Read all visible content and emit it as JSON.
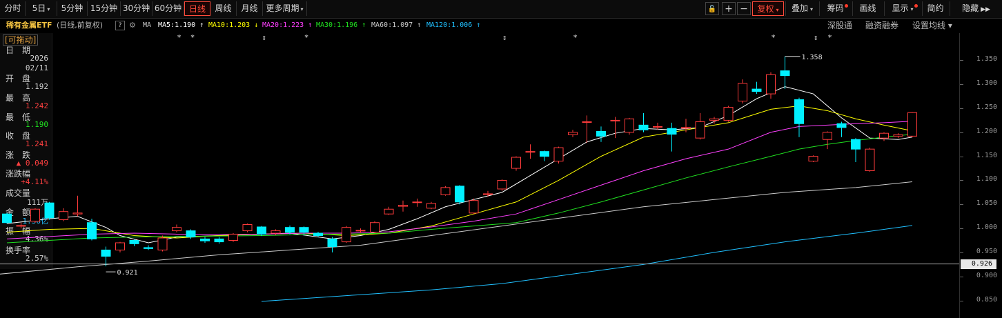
{
  "toolbar": {
    "periods": [
      {
        "label": "分时",
        "caret": false
      },
      {
        "label": "5日",
        "caret": true
      },
      {
        "label": "5分钟",
        "caret": false
      },
      {
        "label": "15分钟",
        "caret": false
      },
      {
        "label": "30分钟",
        "caret": false
      },
      {
        "label": "60分钟",
        "caret": false
      },
      {
        "label": "日线",
        "caret": false,
        "active": true
      },
      {
        "label": "周线",
        "caret": false
      },
      {
        "label": "月线",
        "caret": false
      },
      {
        "label": "更多周期",
        "caret": true
      }
    ],
    "icons": [
      "lock-open-icon",
      "zoom-in-icon",
      "zoom-out-icon"
    ],
    "icon_glyphs": [
      "🔓",
      "+",
      "−"
    ],
    "right_buttons": [
      {
        "label": "复权",
        "caret": true,
        "highlight": true
      },
      {
        "label": "叠加",
        "caret": true
      },
      {
        "label": "筹码",
        "dot": true
      },
      {
        "label": "画线"
      },
      {
        "label": "显示",
        "caret": true,
        "dot": true
      },
      {
        "label": "简约"
      },
      {
        "label": "隐藏",
        "arrows": "▶▶"
      }
    ]
  },
  "info": {
    "name": "稀有金属ETF",
    "mode": "(日线,前复权)",
    "help": "?",
    "ma_tag": "MA",
    "ma": [
      {
        "label": "MA5:1.190",
        "arrow": "↑",
        "color": "#ffffff"
      },
      {
        "label": "MA10:1.203",
        "arrow": "↓",
        "color": "#ffff00"
      },
      {
        "label": "MA20:1.223",
        "arrow": "↑",
        "color": "#ff40ff"
      },
      {
        "label": "MA30:1.196",
        "arrow": "↑",
        "color": "#20e020"
      },
      {
        "label": "MA60:1.097",
        "arrow": "↑",
        "color": "#cccccc"
      },
      {
        "label": "MA120:1.006",
        "arrow": "↑",
        "color": "#20c0ff"
      }
    ],
    "links": [
      "深股通",
      "融资融券",
      "设置均线"
    ]
  },
  "panel": {
    "title": "[可拖动]",
    "rows": [
      {
        "label": "日　期",
        "value": ""
      },
      {
        "label": "",
        "value": "2026"
      },
      {
        "label": "",
        "value": "02/11"
      },
      {
        "label": "开　盘",
        "value": ""
      },
      {
        "label": "",
        "value": "1.192"
      },
      {
        "label": "最　高",
        "value": ""
      },
      {
        "label": "",
        "value": "1.242",
        "color": "#ff4040"
      },
      {
        "label": "最　低",
        "value": ""
      },
      {
        "label": "",
        "value": "1.190",
        "color": "#20e020"
      },
      {
        "label": "收　盘",
        "value": ""
      },
      {
        "label": "",
        "value": "1.241",
        "color": "#ff4040"
      },
      {
        "label": "涨　跌",
        "value": ""
      },
      {
        "label": "",
        "value": "▲ 0.049",
        "color": "#ff4040"
      },
      {
        "label": "涨跌幅",
        "value": ""
      },
      {
        "label": "",
        "value": "+4.11%",
        "color": "#ff4040"
      },
      {
        "label": "成交量",
        "value": ""
      },
      {
        "label": "",
        "value": "111万"
      },
      {
        "label": "金　额",
        "value": ""
      },
      {
        "label": "",
        "value": "1.36亿",
        "color": "#20c0ff"
      },
      {
        "label": "振　幅",
        "value": ""
      },
      {
        "label": "",
        "value": "4.36%"
      },
      {
        "label": "换手率",
        "value": ""
      },
      {
        "label": "",
        "value": "2.57%"
      }
    ]
  },
  "chart_data": {
    "type": "candlestick",
    "ymin": 0.835,
    "ymax": 1.372,
    "yticks": [
      "1.350",
      "1.300",
      "1.250",
      "1.200",
      "1.150",
      "1.100",
      "1.050",
      "1.000",
      "0.950",
      "0.900",
      "0.850"
    ],
    "current_price": "0.926",
    "high_label": "1.358",
    "low_label": "0.921",
    "markers": [
      "*",
      "*",
      "⇕",
      "*",
      "⇕",
      "*",
      "*",
      "⇕",
      "*"
    ],
    "candles": [
      [
        1.03,
        1.012,
        1.032,
        1.01
      ],
      [
        1.006,
        1.006,
        1.012,
        1.0
      ],
      [
        1.015,
        1.04,
        1.042,
        1.012
      ],
      [
        1.053,
        1.022,
        1.055,
        1.018
      ],
      [
        1.018,
        1.035,
        1.042,
        1.015
      ],
      [
        1.03,
        1.032,
        1.068,
        1.025
      ],
      [
        1.012,
        0.978,
        1.02,
        0.975
      ],
      [
        0.955,
        0.942,
        0.962,
        0.921
      ],
      [
        0.955,
        0.97,
        0.972,
        0.95
      ],
      [
        0.975,
        0.968,
        0.978,
        0.963
      ],
      [
        0.96,
        0.958,
        0.965,
        0.955
      ],
      [
        0.955,
        0.98,
        0.985,
        0.952
      ],
      [
        0.995,
        1.002,
        1.008,
        0.992
      ],
      [
        0.995,
        0.982,
        0.998,
        0.978
      ],
      [
        0.978,
        0.974,
        0.982,
        0.97
      ],
      [
        0.978,
        0.972,
        0.982,
        0.968
      ],
      [
        0.975,
        0.988,
        0.99,
        0.972
      ],
      [
        0.995,
        1.008,
        1.01,
        0.992
      ],
      [
        1.003,
        0.988,
        1.005,
        0.984
      ],
      [
        0.99,
        0.995,
        0.998,
        0.986
      ],
      [
        1.002,
        0.992,
        1.006,
        0.988
      ],
      [
        1.002,
        0.992,
        1.004,
        0.985
      ],
      [
        0.99,
        0.985,
        0.993,
        0.982
      ],
      [
        0.978,
        0.962,
        0.982,
        0.95
      ],
      [
        0.972,
        1.002,
        1.005,
        0.97
      ],
      [
        0.995,
        0.996,
        1.0,
        0.99
      ],
      [
        0.992,
        1.012,
        1.015,
        0.99
      ],
      [
        1.03,
        1.04,
        1.045,
        1.028
      ],
      [
        1.046,
        1.048,
        1.058,
        1.035
      ],
      [
        1.055,
        1.055,
        1.062,
        1.045
      ],
      [
        1.042,
        1.052,
        1.055,
        1.04
      ],
      [
        1.07,
        1.085,
        1.088,
        1.068
      ],
      [
        1.088,
        1.055,
        1.09,
        1.05
      ],
      [
        1.032,
        1.058,
        1.062,
        1.03
      ],
      [
        1.072,
        1.072,
        1.078,
        1.066
      ],
      [
        1.082,
        1.1,
        1.102,
        1.078
      ],
      [
        1.125,
        1.148,
        1.15,
        1.12
      ],
      [
        1.16,
        1.16,
        1.175,
        1.145
      ],
      [
        1.16,
        1.15,
        1.162,
        1.14
      ],
      [
        1.14,
        1.168,
        1.17,
        1.135
      ],
      [
        1.195,
        1.2,
        1.205,
        1.19
      ],
      [
        1.222,
        1.222,
        1.235,
        1.178
      ],
      [
        1.202,
        1.192,
        1.212,
        1.18
      ],
      [
        1.225,
        1.225,
        1.232,
        1.188
      ],
      [
        1.2,
        1.228,
        1.23,
        1.195
      ],
      [
        1.215,
        1.205,
        1.24,
        1.2
      ],
      [
        1.212,
        1.212,
        1.22,
        1.205
      ],
      [
        1.208,
        1.196,
        1.22,
        1.16
      ],
      [
        1.21,
        1.21,
        1.228,
        1.2
      ],
      [
        1.188,
        1.222,
        1.24,
        1.185
      ],
      [
        1.225,
        1.228,
        1.232,
        1.218
      ],
      [
        1.225,
        1.252,
        1.255,
        1.222
      ],
      [
        1.265,
        1.302,
        1.31,
        1.26
      ],
      [
        1.29,
        1.285,
        1.305,
        1.28
      ],
      [
        1.28,
        1.32,
        1.325,
        1.27
      ],
      [
        1.328,
        1.318,
        1.358,
        1.29
      ],
      [
        1.268,
        1.218,
        1.272,
        1.19
      ],
      [
        1.14,
        1.15,
        1.152,
        1.138
      ],
      [
        1.185,
        1.2,
        1.202,
        1.165
      ],
      [
        1.218,
        1.21,
        1.222,
        1.19
      ],
      [
        1.185,
        1.165,
        1.188,
        1.138
      ],
      [
        1.12,
        1.165,
        1.168,
        1.118
      ],
      [
        1.188,
        1.198,
        1.2,
        1.182
      ],
      [
        1.192,
        1.195,
        1.198,
        1.188
      ],
      [
        1.192,
        1.241,
        1.242,
        1.19
      ]
    ],
    "ma_lines": [
      {
        "name": "MA5",
        "color": "#ffffff",
        "x": [
          0,
          3,
          5,
          7,
          8,
          10,
          12,
          15,
          18,
          20,
          23,
          25,
          27,
          29,
          31,
          33,
          35,
          37,
          39,
          41,
          43,
          45,
          47,
          49,
          51,
          53,
          55,
          57,
          59,
          61,
          63,
          64
        ],
        "y": [
          1.01,
          1.02,
          1.025,
          1.002,
          0.985,
          0.97,
          0.982,
          0.985,
          0.988,
          0.99,
          0.978,
          0.985,
          0.998,
          1.02,
          1.045,
          1.06,
          1.075,
          1.11,
          1.145,
          1.18,
          1.198,
          1.208,
          1.205,
          1.21,
          1.235,
          1.27,
          1.295,
          1.28,
          1.23,
          1.188,
          1.185,
          1.19
        ]
      },
      {
        "name": "MA10",
        "color": "#ffff00",
        "x": [
          0,
          3,
          6,
          9,
          12,
          15,
          18,
          21,
          24,
          27,
          30,
          33,
          36,
          39,
          42,
          45,
          48,
          51,
          54,
          56,
          58,
          60,
          62,
          64
        ],
        "y": [
          0.992,
          0.998,
          1.0,
          0.985,
          0.98,
          0.985,
          0.988,
          0.99,
          0.985,
          0.99,
          1.005,
          1.03,
          1.055,
          1.1,
          1.15,
          1.19,
          1.205,
          1.22,
          1.248,
          1.255,
          1.245,
          1.228,
          1.215,
          1.203
        ]
      },
      {
        "name": "MA20",
        "color": "#ff40ff",
        "x": [
          0,
          3,
          6,
          9,
          12,
          15,
          18,
          21,
          24,
          27,
          30,
          33,
          36,
          39,
          42,
          45,
          48,
          51,
          54,
          56,
          58,
          60,
          62,
          64
        ],
        "y": [
          0.978,
          0.983,
          0.988,
          0.99,
          0.988,
          0.987,
          0.988,
          0.99,
          0.99,
          0.993,
          1.003,
          1.015,
          1.03,
          1.06,
          1.09,
          1.12,
          1.145,
          1.165,
          1.2,
          1.212,
          1.215,
          1.218,
          1.22,
          1.223
        ]
      },
      {
        "name": "MA30",
        "color": "#20e020",
        "x": [
          0,
          3,
          6,
          9,
          12,
          15,
          18,
          21,
          24,
          27,
          30,
          33,
          36,
          39,
          42,
          45,
          48,
          51,
          54,
          56,
          58,
          60,
          62,
          64
        ],
        "y": [
          0.97,
          0.975,
          0.98,
          0.982,
          0.983,
          0.984,
          0.985,
          0.987,
          0.988,
          0.99,
          0.998,
          1.005,
          1.012,
          1.032,
          1.055,
          1.08,
          1.105,
          1.128,
          1.15,
          1.165,
          1.175,
          1.183,
          1.19,
          1.196
        ]
      },
      {
        "name": "MA60",
        "color": "#cccccc",
        "x": [
          -3,
          5,
          10,
          15,
          20,
          25,
          30,
          35,
          40,
          45,
          50,
          55,
          60,
          64
        ],
        "y": [
          0.898,
          0.92,
          0.932,
          0.945,
          0.955,
          0.965,
          0.985,
          1.005,
          1.025,
          1.045,
          1.06,
          1.075,
          1.085,
          1.097
        ]
      },
      {
        "name": "MA120",
        "color": "#20c0ff",
        "x": [
          18,
          25,
          30,
          35,
          40,
          45,
          50,
          55,
          60,
          64
        ],
        "y": [
          0.848,
          0.862,
          0.872,
          0.885,
          0.905,
          0.925,
          0.95,
          0.972,
          0.99,
          1.006
        ]
      }
    ]
  }
}
